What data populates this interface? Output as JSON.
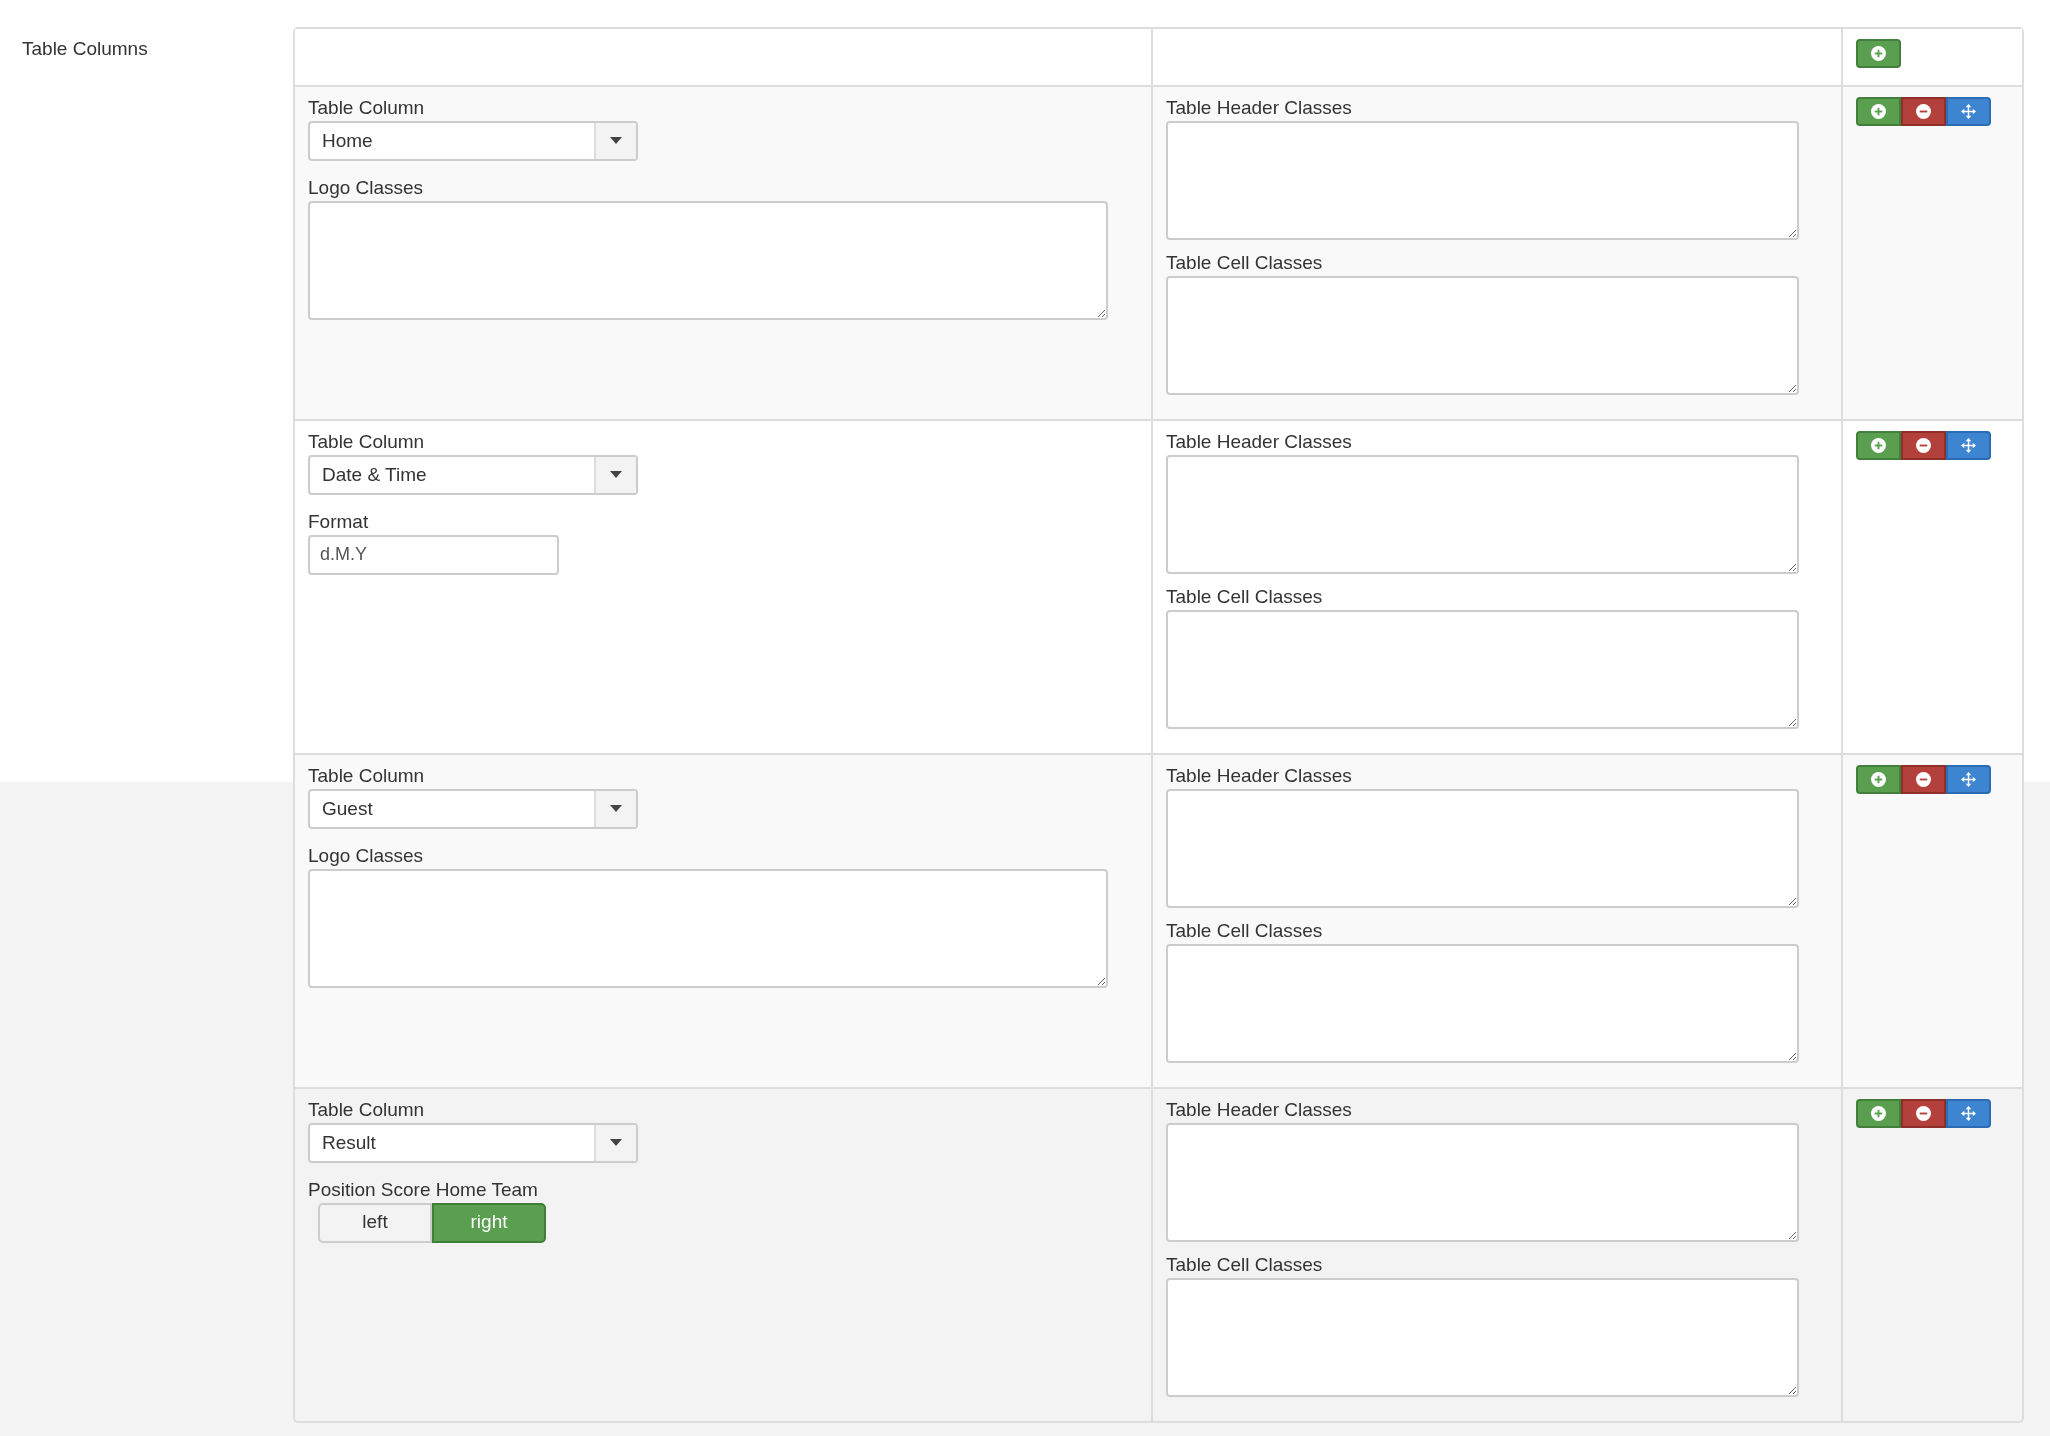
{
  "field_label": "Table Columns",
  "rows": [
    {
      "column_label": "Table Column",
      "column_value": "Home",
      "extra": {
        "kind": "textarea",
        "label": "Logo Classes"
      },
      "header_label": "Table Header Classes",
      "cell_label": "Table Cell Classes"
    },
    {
      "column_label": "Table Column",
      "column_value": "Date & Time",
      "extra": {
        "kind": "input",
        "label": "Format",
        "value": "d.M.Y"
      },
      "header_label": "Table Header Classes",
      "cell_label": "Table Cell Classes"
    },
    {
      "column_label": "Table Column",
      "column_value": "Guest",
      "extra": {
        "kind": "textarea",
        "label": "Logo Classes"
      },
      "header_label": "Table Header Classes",
      "cell_label": "Table Cell Classes"
    },
    {
      "column_label": "Table Column",
      "column_value": "Result",
      "extra": {
        "kind": "toggle",
        "label": "Position Score Home Team",
        "options": [
          {
            "label": "left",
            "selected": false
          },
          {
            "label": "right",
            "selected": true
          }
        ]
      },
      "header_label": "Table Header Classes",
      "cell_label": "Table Cell Classes"
    }
  ]
}
